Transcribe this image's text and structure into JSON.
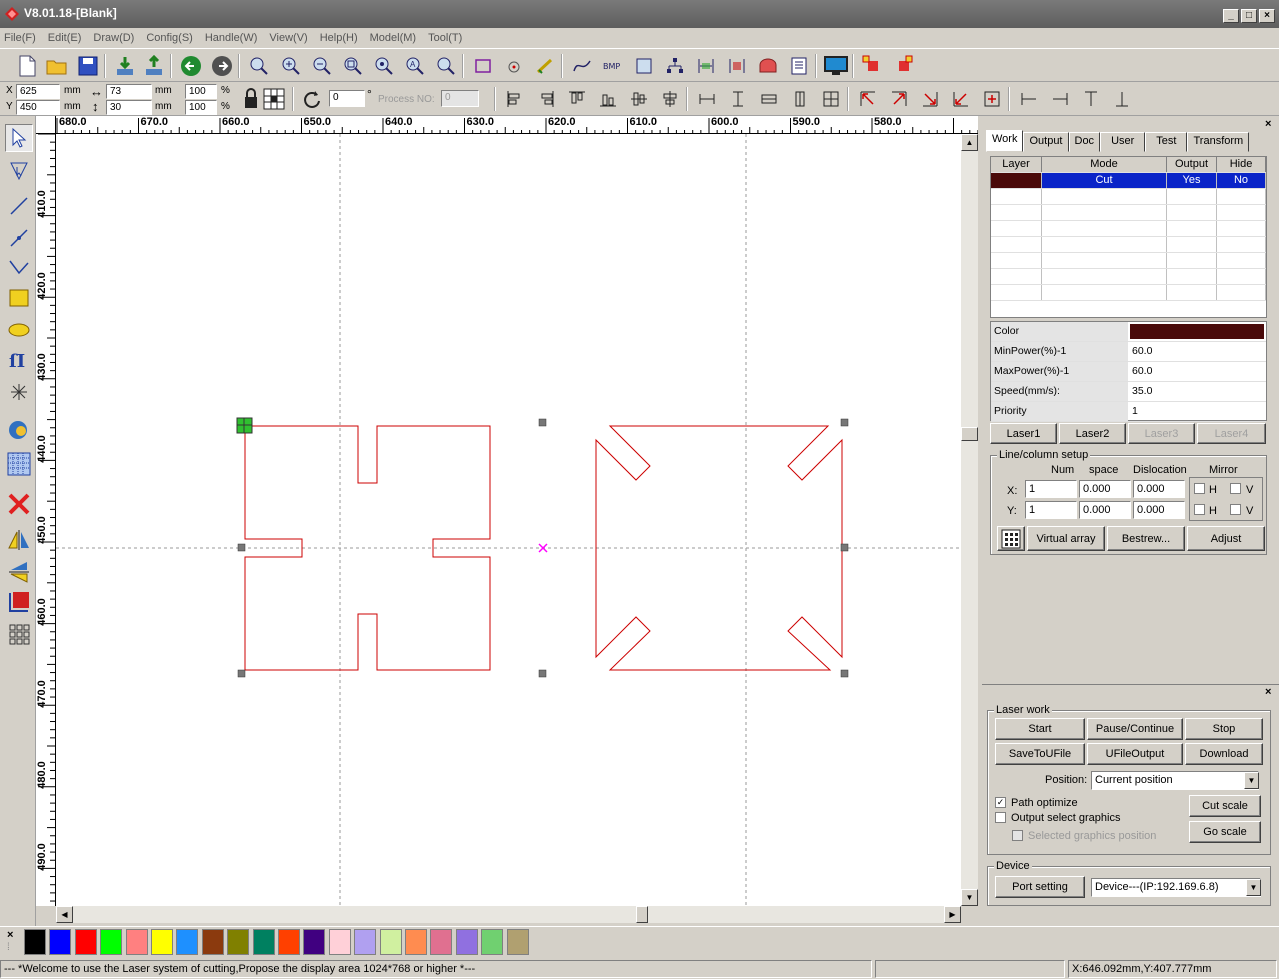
{
  "window": {
    "title": "V8.01.18-[Blank]",
    "controls": [
      "_",
      "□",
      "×"
    ]
  },
  "menu": [
    "File(F)",
    "Edit(E)",
    "Draw(D)",
    "Config(S)",
    "Handle(W)",
    "View(V)",
    "Help(H)",
    "Model(M)",
    "Tool(T)"
  ],
  "toolbar2": {
    "x_label": "X",
    "y_label": "Y",
    "x_value": "625",
    "y_value": "450",
    "w_value": "73",
    "h_value": "30",
    "unit": "mm",
    "sx_value": "100",
    "sy_value": "100",
    "pct": "%",
    "rotate_value": "0",
    "deg": "°",
    "process_label": "Process NO:",
    "process_value": "0"
  },
  "ruler": {
    "h_ticks": [
      "680.0",
      "670.0",
      "660.0",
      "650.0",
      "640.0",
      "630.0",
      "620.0",
      "610.0",
      "600.0",
      "590.0",
      "580.0"
    ],
    "v_ticks": [
      "410.0",
      "420.0",
      "430.0",
      "440.0",
      "450.0",
      "460.0",
      "470.0",
      "480.0",
      "490.0"
    ]
  },
  "panel": {
    "tabs": [
      "Work",
      "Output",
      "Doc",
      "User",
      "Test",
      "Transform"
    ],
    "layer_headers": [
      "Layer",
      "Mode",
      "Output",
      "Hide"
    ],
    "layer_rows": [
      {
        "color": "#4a0a0a",
        "mode": "Cut",
        "output": "Yes",
        "hide": "No"
      }
    ],
    "props": [
      {
        "name": "Color",
        "value": ""
      },
      {
        "name": "MinPower(%)-1",
        "value": "60.0"
      },
      {
        "name": "MaxPower(%)-1",
        "value": "60.0"
      },
      {
        "name": "Speed(mm/s):",
        "value": "35.0"
      },
      {
        "name": "Priority",
        "value": "1"
      }
    ],
    "layer_color": "#4a0a0a",
    "laser_buttons": [
      "Laser1",
      "Laser2",
      "Laser3",
      "Laser4"
    ],
    "linecol": {
      "title": "Line/column setup",
      "num": "Num",
      "space": "space",
      "dislocation": "Dislocation",
      "mirror": "Mirror",
      "x_label": "X:",
      "y_label": "Y:",
      "x_num": "1",
      "x_space": "0.000",
      "x_disl": "0.000",
      "y_num": "1",
      "y_space": "0.000",
      "y_disl": "0.000",
      "h": "H",
      "v": "V",
      "virtual_array": "Virtual array",
      "bestrew": "Bestrew...",
      "adjust": "Adjust"
    }
  },
  "laserwork": {
    "title": "Laser work",
    "start": "Start",
    "pause": "Pause/Continue",
    "stop": "Stop",
    "save": "SaveToUFile",
    "ufile": "UFileOutput",
    "download": "Download",
    "position_label": "Position:",
    "position_value": "Current position",
    "path_optimize": "Path optimize",
    "output_select": "Output select graphics",
    "selected_pos": "Selected graphics position",
    "cut_scale": "Cut scale",
    "go_scale": "Go scale"
  },
  "device": {
    "title": "Device",
    "port_setting": "Port setting",
    "device_value": "Device---(IP:192.169.6.8)"
  },
  "palette": [
    "#000000",
    "#0000ff",
    "#ff0000",
    "#00ff00",
    "#ff8080",
    "#ffff00",
    "#1e90ff",
    "#8b3a0e",
    "#808000",
    "#008060",
    "#ff4000",
    "#400080",
    "#ffd0d8",
    "#b0a0f0",
    "#d0f0a0",
    "#ff8c50",
    "#e07090",
    "#9070e0",
    "#70d070",
    "#b0a070"
  ],
  "status": {
    "message": "--- *Welcome to use the Laser system of cutting,Propose the display area 1024*768 or higher *---",
    "coords": "X:646.092mm,Y:407.777mm"
  },
  "colors": {
    "shape_stroke": "#cc0000",
    "center_mark": "#ff00ff",
    "selection_handle": "#22aa22"
  }
}
